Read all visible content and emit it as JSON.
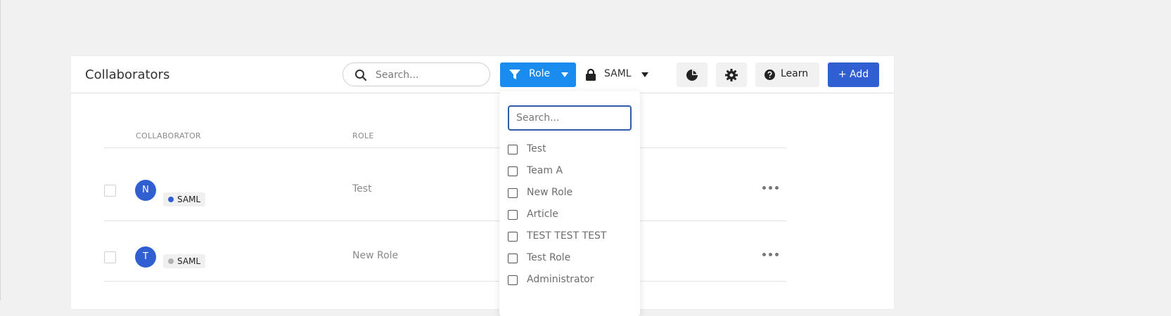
{
  "header": {
    "title": "Collaborators",
    "search_placeholder": "Search...",
    "role_filter_label": "Role",
    "saml_filter_label": "SAML",
    "learn_label": "Learn",
    "add_label": "+ Add"
  },
  "colors": {
    "primary_blue": "#1a8cf0",
    "add_blue": "#2f5fd0",
    "avatar_blue": "#2f5fd0",
    "saml_active_dot": "#2f5fd0",
    "saml_inactive_dot": "#b0b0b0"
  },
  "table": {
    "columns": [
      "COLLABORATOR",
      "ROLE"
    ],
    "rows": [
      {
        "initial": "N",
        "tag": "SAML",
        "tag_status": "active",
        "role": "Test"
      },
      {
        "initial": "T",
        "tag": "SAML",
        "tag_status": "inactive",
        "role": "New Role"
      }
    ]
  },
  "role_dropdown": {
    "search_placeholder": "Search...",
    "options": [
      "Test",
      "Team A",
      "New Role",
      "Article",
      "TEST TEST TEST",
      "Test Role",
      "Administrator"
    ]
  },
  "icons": {
    "search": "search-icon",
    "filter": "filter-icon",
    "lock": "lock-icon",
    "chart": "pie-chart-icon",
    "settings": "gear-icon",
    "help": "help-circle-icon",
    "more": "more-horizontal-icon"
  }
}
